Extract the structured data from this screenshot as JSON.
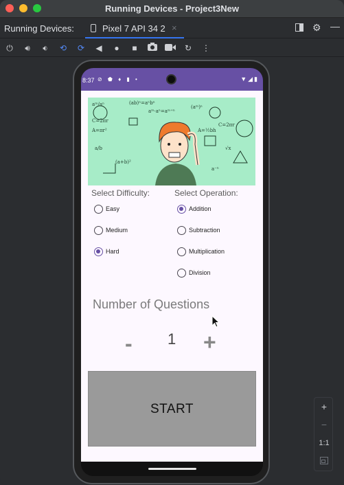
{
  "window": {
    "title": "Running Devices - Project3New"
  },
  "toolwindow": {
    "label": "Running Devices:",
    "tab_label": "Pixel 7 API 34 2",
    "tab_close": "×"
  },
  "toolbar_icons": [
    "power-icon",
    "volume-up-icon",
    "volume-down-icon",
    "rotate-left-icon",
    "rotate-right-icon",
    "back-icon",
    "home-icon",
    "overview-icon",
    "camera-icon",
    "screen-record-icon",
    "reset-icon",
    "more-icon"
  ],
  "device": {
    "status_time": "8:37",
    "status_icons_left": [
      "shield-icon",
      "sim-icon",
      "mic-icon",
      "sd-icon",
      "dot-icon"
    ],
    "status_icons_right": [
      "wifi-icon",
      "signal-icon",
      "battery-icon"
    ]
  },
  "app": {
    "difficulty_label": "Select Difficulty:",
    "operation_label": "Select Operation:",
    "difficulties": [
      {
        "label": "Easy",
        "checked": false
      },
      {
        "label": "Medium",
        "checked": false
      },
      {
        "label": "Hard",
        "checked": true
      }
    ],
    "operations": [
      {
        "label": "Addition",
        "checked": true
      },
      {
        "label": "Subtraction",
        "checked": false
      },
      {
        "label": "Multiplication",
        "checked": false
      },
      {
        "label": "Division",
        "checked": false
      }
    ],
    "num_questions_label": "Number of Questions",
    "minus_label": "-",
    "plus_label": "+",
    "num_questions_value": "1",
    "start_label": "START",
    "hero_formulas": [
      "(ab)ⁿ=aⁿbⁿ",
      "aᵐ·aⁿ=aᵐ⁺ⁿ",
      "C=2πr",
      "A=πr²",
      "a/b",
      "√x",
      "C=2πr",
      "A=½bh",
      "(aᵐ)ⁿ",
      "aᵐ/aⁿ",
      "a⁻ⁿ",
      "(a+b)²"
    ]
  },
  "zoom_controls": {
    "zoom_in": "+",
    "zoom_out": "−",
    "actual_size": "1:1"
  },
  "colors": {
    "accent": "#6750a4",
    "hero_bg": "#a7ecc8",
    "start_bg": "#9a9a9a"
  }
}
